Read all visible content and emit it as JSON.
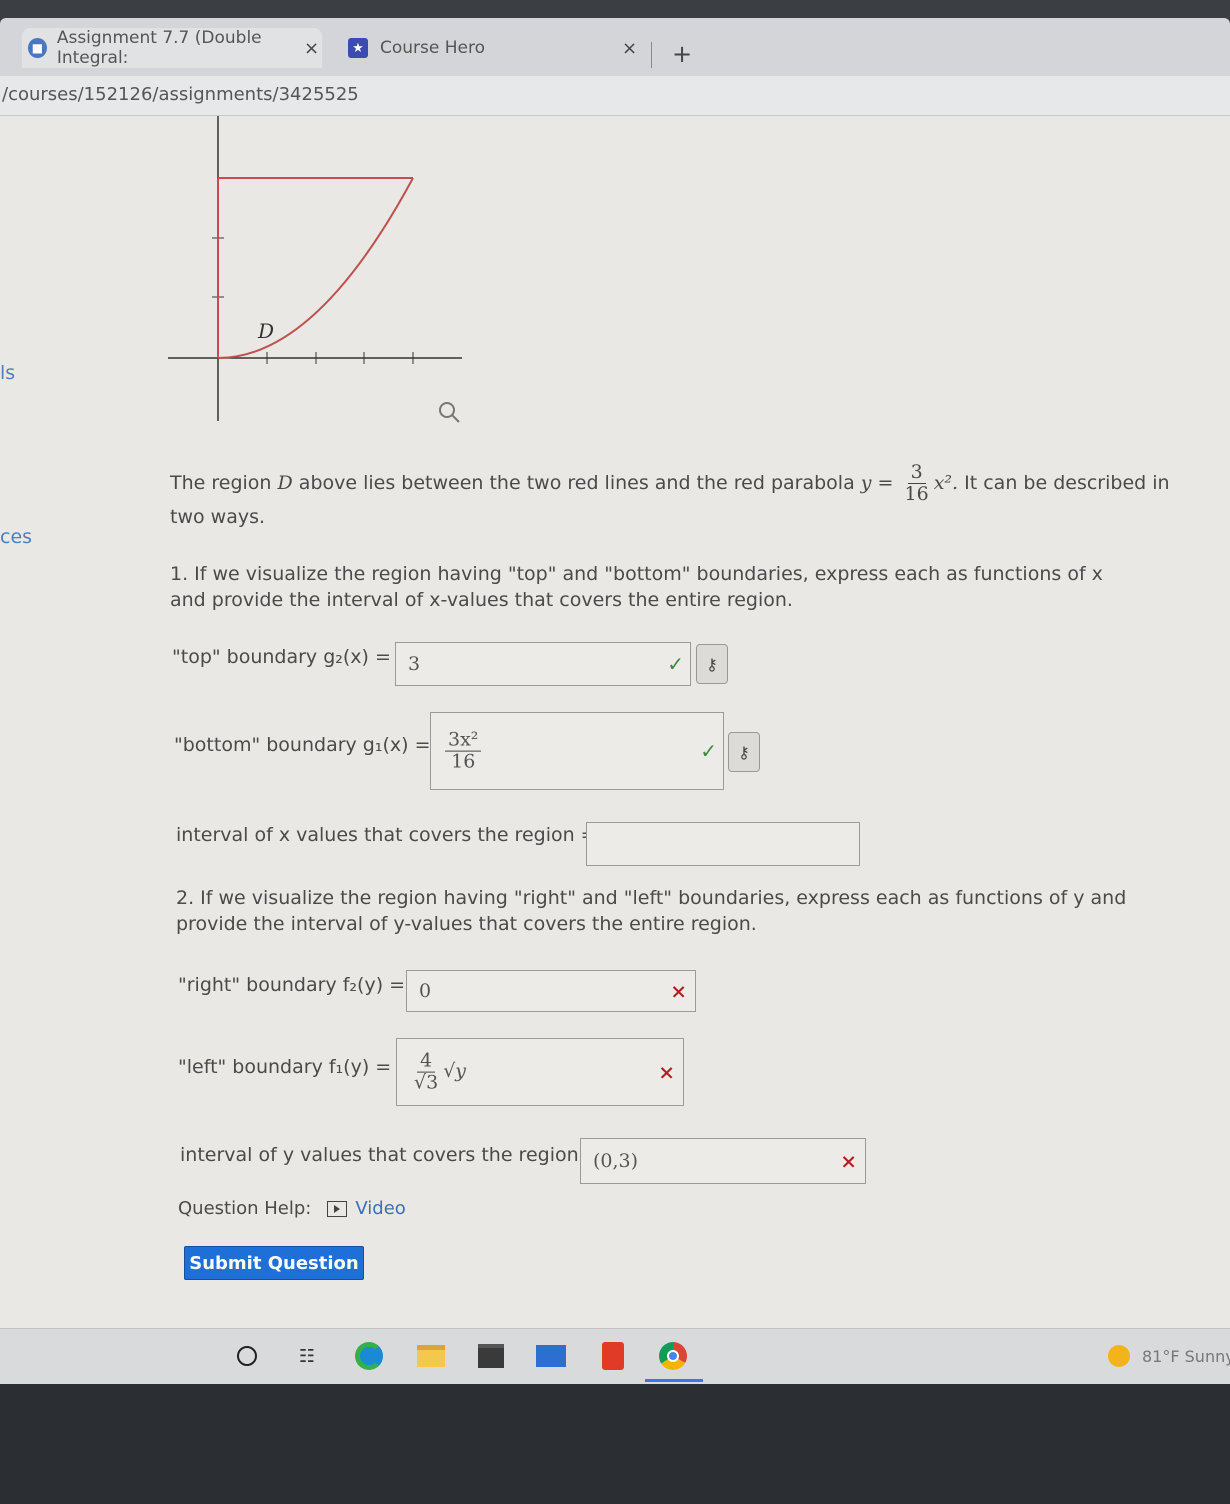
{
  "browser": {
    "tabs": [
      {
        "label": "Assignment 7.7 (Double Integral:",
        "icon": "course-site-icon"
      },
      {
        "label": "Course Hero",
        "icon": "course-hero-star-icon"
      }
    ],
    "tab_close": "×",
    "new_tab": "+",
    "url": "/courses/152126/assignments/3425525"
  },
  "sidebar": {
    "link1": "ls",
    "link2": "ces"
  },
  "graph": {
    "region_label": "D",
    "curve_color": "#c0504d"
  },
  "question": {
    "intro_part1": "The region",
    "intro_var": "D",
    "intro_part2": "above lies between the two red lines and the red parabola",
    "parabola_lhs": "y =",
    "parabola_num": "3",
    "parabola_den": "16",
    "parabola_rhs": "x².",
    "intro_part3": "It can be described in two ways.",
    "part1_text": "1. If we visualize the region having \"top\" and \"bottom\" boundaries, express each as functions of x and provide the interval of x-values that covers the entire region.",
    "part2_text": "2. If we visualize the region having \"right\" and \"left\" boundaries, express each as functions of y and provide the interval of y-values that covers the entire region.",
    "rows": {
      "top": {
        "label": "\"top\" boundary g₂(x) =",
        "value": "3",
        "status": "correct"
      },
      "bottom": {
        "label": "\"bottom\" boundary g₁(x) =",
        "value_num": "3x²",
        "value_den": "16",
        "status": "correct"
      },
      "x_interval": {
        "label": "interval of x values that covers the region =",
        "value": ""
      },
      "right": {
        "label": "\"right\" boundary f₂(y) =",
        "value": "0",
        "status": "incorrect"
      },
      "left": {
        "label": "\"left\" boundary f₁(y) =",
        "value_num": "4",
        "value_den": "√3",
        "value_tail": "√y",
        "status": "incorrect"
      },
      "y_interval": {
        "label": "interval of y values that covers the region =",
        "value": "(0,3)",
        "status": "incorrect"
      }
    },
    "check_mark": "✓",
    "x_mark": "×",
    "key_icon": "⚷",
    "help_label": "Question Help:",
    "video_label": "Video",
    "submit_label": "Submit Question"
  },
  "taskbar": {
    "icons": [
      "cortana-circle-icon",
      "task-view-icon",
      "edge-icon",
      "file-explorer-icon",
      "store-icon",
      "mail-icon",
      "office-icon",
      "chrome-icon"
    ],
    "weather": "81°F  Sunny"
  }
}
